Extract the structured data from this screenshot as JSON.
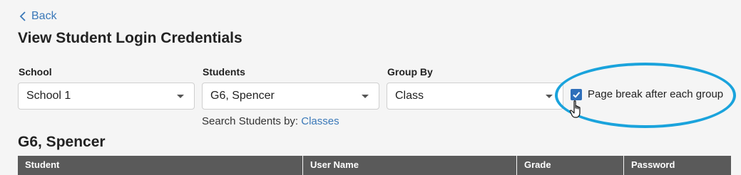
{
  "nav": {
    "back_label": "Back"
  },
  "page": {
    "title": "View Student Login Credentials"
  },
  "filters": {
    "school": {
      "label": "School",
      "value": "School 1"
    },
    "students": {
      "label": "Students",
      "value": "G6, Spencer"
    },
    "group_by": {
      "label": "Group By",
      "value": "Class"
    },
    "search_by_text": "Search Students by:",
    "search_by_link": "Classes",
    "page_break": {
      "label": "Page break after each group",
      "checked": true
    }
  },
  "group": {
    "title": "G6, Spencer"
  },
  "table": {
    "columns": [
      "Student",
      "User Name",
      "Grade",
      "Password"
    ]
  },
  "colors": {
    "link": "#3a78b8",
    "checkbox": "#2f6fba",
    "highlight_ring": "#1aa3dc",
    "table_header": "#5a5a5a"
  }
}
